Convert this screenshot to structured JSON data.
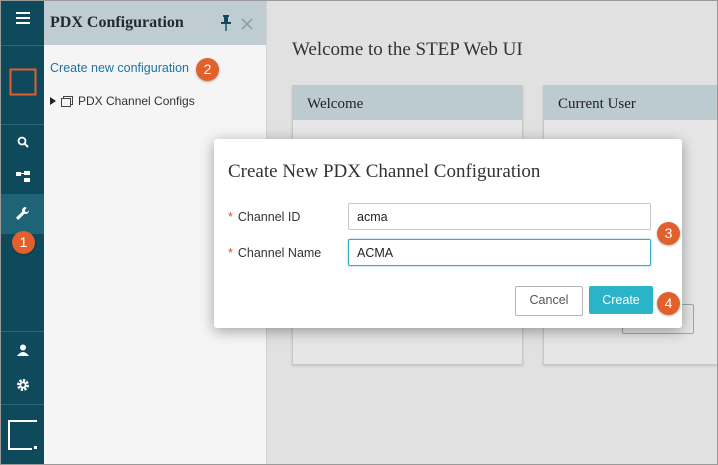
{
  "rail": {
    "menu_icon": "hamburger-icon",
    "items": [
      "search-icon",
      "hierarchy-icon",
      "wrench-icon",
      "user-icon",
      "gear-icon"
    ]
  },
  "panel": {
    "title": "PDX Configuration",
    "create_link": "Create new configuration",
    "tree_item": "PDX Channel Configs"
  },
  "main": {
    "title": "Welcome to the STEP Web UI",
    "cards": [
      {
        "title": "Welcome"
      },
      {
        "title": "Current User"
      }
    ]
  },
  "dialog": {
    "title": "Create New PDX Channel Configuration",
    "fields": [
      {
        "label": "Channel ID",
        "value": "acma"
      },
      {
        "label": "Channel Name",
        "value": "ACMA"
      }
    ],
    "required_mark": "*",
    "cancel_label": "Cancel",
    "create_label": "Create"
  },
  "callouts": [
    "1",
    "2",
    "3",
    "4"
  ],
  "colors": {
    "rail": "#0e4a5c",
    "accent": "#2bb3c9",
    "callout": "#e2602c",
    "link": "#1d74a3"
  }
}
